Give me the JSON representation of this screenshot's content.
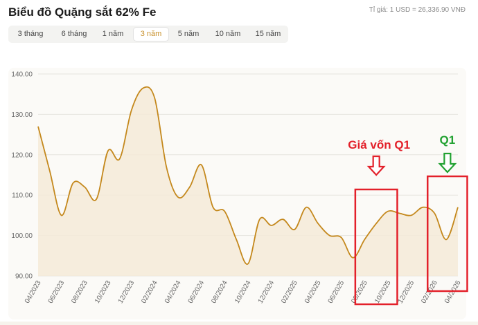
{
  "header": {
    "title": "Biểu đồ Quặng sắt 62% Fe",
    "exchange_rate": "Tỉ giá: 1 USD = 26,336.90 VNĐ"
  },
  "tabs": [
    {
      "label": "3 tháng",
      "active": false
    },
    {
      "label": "6 tháng",
      "active": false
    },
    {
      "label": "1 năm",
      "active": false
    },
    {
      "label": "3 năm",
      "active": true
    },
    {
      "label": "5 năm",
      "active": false
    },
    {
      "label": "10 năm",
      "active": false
    },
    {
      "label": "15 năm",
      "active": false
    }
  ],
  "chart_data": {
    "type": "area",
    "title": "Biểu đồ Quặng sắt 62% Fe",
    "xlabel": "",
    "ylabel": "",
    "ylim": [
      90,
      140
    ],
    "yticks": [
      90,
      100,
      110,
      120,
      130,
      140
    ],
    "ytick_labels": [
      "90.00",
      "100.00",
      "110.00",
      "120.00",
      "130.00",
      "140.00"
    ],
    "xticks": [
      "04/2023",
      "06/2023",
      "08/2023",
      "10/2023",
      "12/2023",
      "02/2024",
      "04/2024",
      "06/2024",
      "08/2024",
      "10/2024",
      "12/2024",
      "02/2025",
      "04/2025",
      "06/2025",
      "08/2025",
      "10/2025",
      "12/2025",
      "02/2026",
      "04/2026"
    ],
    "grid": true,
    "legend": "none",
    "colors": {
      "line": "#c4881c",
      "fill": "#f5ead8",
      "annotation": "#e3202a",
      "annotation_green": "#21a131"
    },
    "series": [
      {
        "x": [
          0,
          0.5,
          1,
          1.5,
          2,
          2.5,
          3,
          3.5,
          4,
          4.5,
          5,
          5.5,
          6,
          6.5,
          7,
          7.5,
          8,
          8.5,
          9,
          9.5,
          10,
          10.5,
          11,
          11.5,
          12,
          12.5,
          13,
          13.5,
          14,
          14.5,
          15,
          15.5,
          16,
          16.5,
          17,
          17.5,
          18
        ],
        "values": [
          127,
          116,
          105,
          113,
          112,
          109,
          121,
          119,
          131,
          136.5,
          134,
          117,
          109.5,
          112,
          117.5,
          107,
          106,
          99,
          93,
          104,
          102.5,
          104,
          101.5,
          107,
          103,
          100,
          99.5,
          94.5,
          99,
          103,
          106,
          105.5,
          105,
          107,
          105.5,
          99,
          107
        ]
      }
    ],
    "annotations": [
      {
        "label": "Giá vốn Q1",
        "color": "#e3202a",
        "x_from": 13.6,
        "x_to": 15.4
      },
      {
        "label": "Q1",
        "color": "#21a131",
        "x_from": 16.7,
        "x_to": 18.4
      }
    ]
  }
}
